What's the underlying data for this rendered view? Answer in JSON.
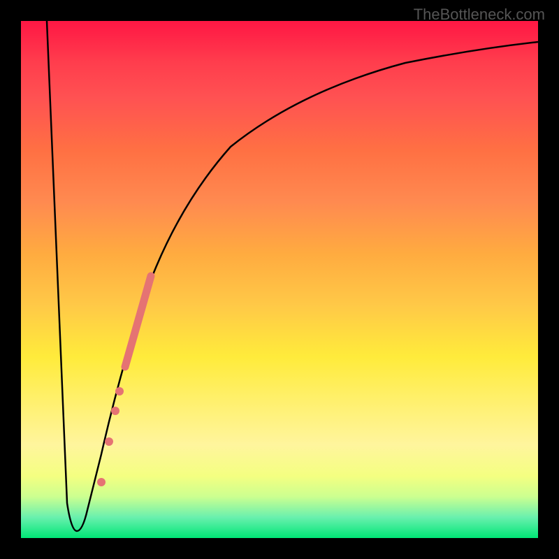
{
  "watermark": "TheBottleneck.com",
  "chart_data": {
    "type": "line",
    "title": "",
    "xlabel": "",
    "ylabel": "",
    "xlim": [
      0,
      100
    ],
    "ylim": [
      0,
      100
    ],
    "curve": {
      "description": "Bottleneck curve with steep V notch near x=10 then asymptotic rise",
      "points": [
        {
          "x": 5,
          "y": 100
        },
        {
          "x": 9,
          "y": 12
        },
        {
          "x": 10,
          "y": 2
        },
        {
          "x": 12,
          "y": 2
        },
        {
          "x": 13,
          "y": 5
        },
        {
          "x": 18,
          "y": 25
        },
        {
          "x": 23,
          "y": 45
        },
        {
          "x": 30,
          "y": 62
        },
        {
          "x": 40,
          "y": 77
        },
        {
          "x": 55,
          "y": 87
        },
        {
          "x": 75,
          "y": 93
        },
        {
          "x": 100,
          "y": 96
        }
      ]
    },
    "markers": {
      "description": "Salmon colored dots along rising portion of curve",
      "dots": [
        {
          "x": 15.5,
          "y": 11
        },
        {
          "x": 17,
          "y": 19
        },
        {
          "x": 18.2,
          "y": 25
        },
        {
          "x": 19,
          "y": 29
        }
      ],
      "cluster": {
        "start": {
          "x": 20,
          "y": 34
        },
        "end": {
          "x": 25,
          "y": 51
        }
      }
    }
  }
}
